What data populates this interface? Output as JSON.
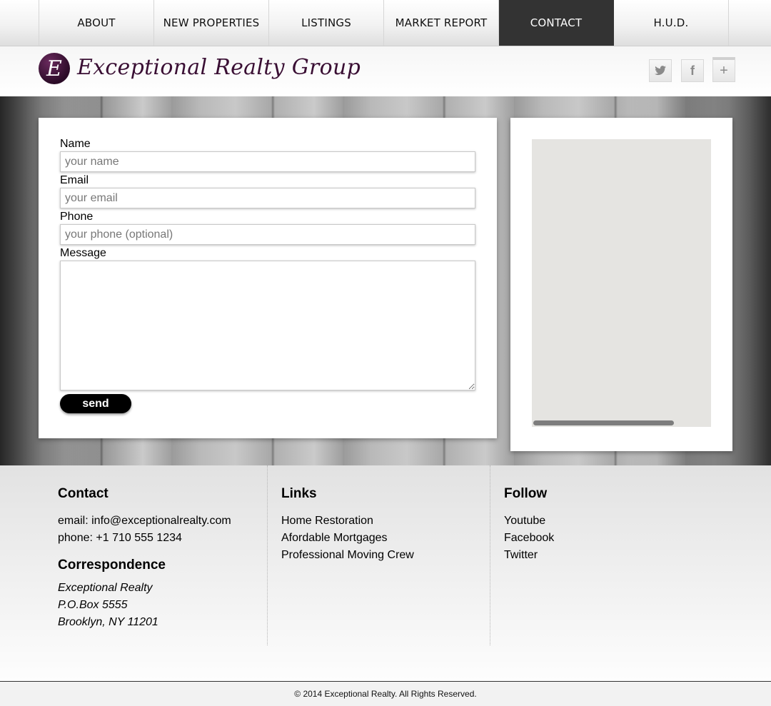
{
  "nav": {
    "items": [
      {
        "label": "ABOUT"
      },
      {
        "label": "NEW PROPERTIES"
      },
      {
        "label": "LISTINGS"
      },
      {
        "label": "MARKET REPORT"
      },
      {
        "label": "CONTACT",
        "active": true
      },
      {
        "label": "H.U.D."
      }
    ]
  },
  "header": {
    "logo_letter": "E",
    "logo_text": "Exceptional Realty Group",
    "social": [
      {
        "name": "twitter-icon",
        "glyph": "🐦"
      },
      {
        "name": "facebook-icon",
        "glyph": "f"
      },
      {
        "name": "google-plus-icon",
        "glyph": "+"
      }
    ]
  },
  "form": {
    "name_label": "Name",
    "name_placeholder": "your name",
    "email_label": "Email",
    "email_placeholder": "your email",
    "phone_label": "Phone",
    "phone_placeholder": "your phone (optional)",
    "message_label": "Message",
    "send_label": "send"
  },
  "footer": {
    "contact": {
      "heading": "Contact",
      "email": "email: info@exceptionalrealty.com",
      "phone": "phone: +1 710 555 1234"
    },
    "correspondence": {
      "heading": "Correspondence",
      "lines": [
        "Exceptional Realty",
        "P.O.Box 5555",
        "Brooklyn, NY 11201"
      ]
    },
    "links": {
      "heading": "Links",
      "items": [
        "Home Restoration",
        "Afordable Mortgages",
        "Professional Moving Crew"
      ]
    },
    "follow": {
      "heading": "Follow",
      "items": [
        "Youtube",
        "Facebook",
        "Twitter"
      ]
    },
    "copyright": "© 2014 Exceptional Realty. All Rights Reserved."
  }
}
